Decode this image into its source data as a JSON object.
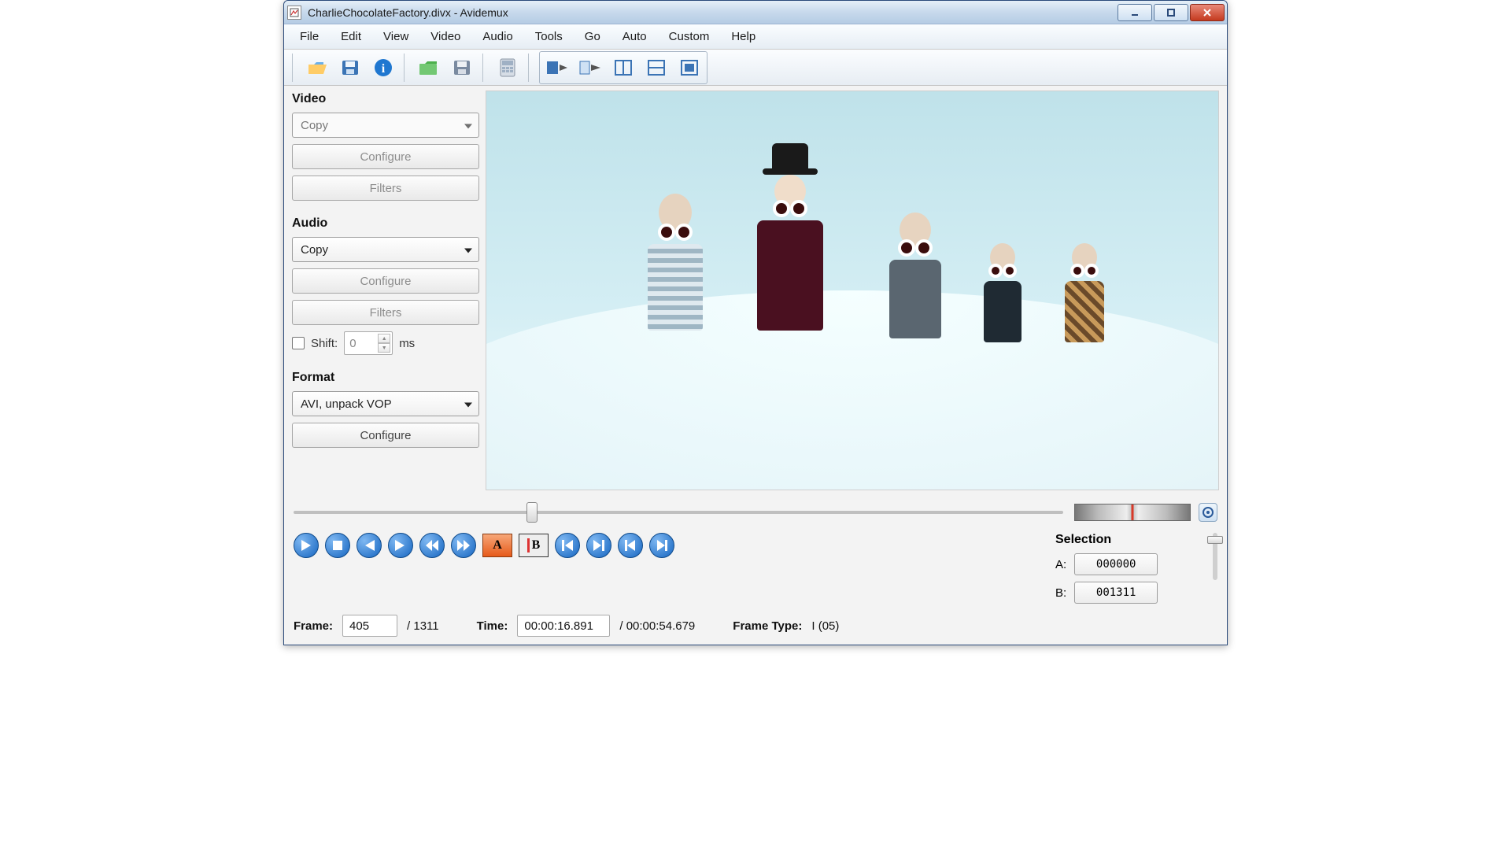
{
  "title": "CharlieChocolateFactory.divx - Avidemux",
  "menu": [
    "File",
    "Edit",
    "View",
    "Video",
    "Audio",
    "Tools",
    "Go",
    "Auto",
    "Custom",
    "Help"
  ],
  "sidebar": {
    "video_label": "Video",
    "video_codec": "Copy",
    "video_configure": "Configure",
    "video_filters": "Filters",
    "audio_label": "Audio",
    "audio_codec": "Copy",
    "audio_configure": "Configure",
    "audio_filters": "Filters",
    "shift_label": "Shift:",
    "shift_value": "0",
    "shift_unit": "ms",
    "format_label": "Format",
    "format_value": "AVI, unpack VOP",
    "format_configure": "Configure"
  },
  "timeline": {
    "position_percent": 31
  },
  "status": {
    "frame_label": "Frame:",
    "frame_value": "405",
    "frame_total": "/ 1311",
    "time_label": "Time:",
    "time_value": "00:00:16.891",
    "time_total": "/ 00:00:54.679",
    "frametype_label": "Frame Type:",
    "frametype_value": "I (05)"
  },
  "selection": {
    "label": "Selection",
    "a_label": "A:",
    "a_value": "000000",
    "b_label": "B:",
    "b_value": "001311"
  },
  "toolbar_icons": [
    "open",
    "save",
    "info",
    "open-folder",
    "save-as",
    "calculator",
    "append",
    "export-selection",
    "crop",
    "letterbox",
    "resize"
  ]
}
